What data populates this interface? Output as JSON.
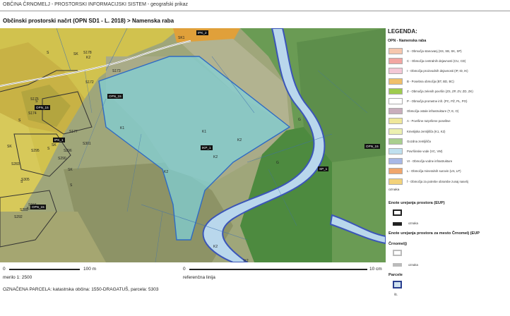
{
  "header": "OBČINA ČRNOMELJ - PROSTORSKI INFORMACIJSKI SISTEM - geografski prikaz",
  "title": "Občinski prostorski načrt (OPN SD1 - L. 2018) > Namenska raba",
  "map": {
    "labels": [
      "K1",
      "K1",
      "K2",
      "K2",
      "K2",
      "K2",
      "K2",
      "K2",
      "S",
      "S",
      "S",
      "S",
      "S",
      "S",
      "SK",
      "SK",
      "SK",
      "SK",
      "SK1",
      "S178",
      "S175",
      "S173",
      "S174",
      "S177",
      "S301",
      "S295",
      "S296",
      "S283",
      "S290",
      "S244",
      "S289",
      "S292",
      "S305",
      "S173",
      "S172",
      "R",
      "G",
      "G",
      "Vr2"
    ],
    "tags": [
      "OPN_15",
      "OPN_15",
      "OPN_15",
      "IPK_1",
      "IKP_1",
      "IPK_2",
      "SP_1",
      "OPN_15"
    ]
  },
  "legend": {
    "title": "LEGENDA:",
    "subtitle": "OPN - Namenska raba",
    "items": [
      {
        "label": "S - Območja stanovanj (SS, SB, SK, SP)",
        "color": "#f6c7ae"
      },
      {
        "label": "C - Območja centralnih dejavnosti (CU, CD)",
        "color": "#f2a6a2"
      },
      {
        "label": "I - Območja proizvodnih dejavnosti (IP, ID, IK)",
        "color": "#f4c8d6"
      },
      {
        "label": "B - Posebna območja (BT, BD, BC)",
        "color": "#f0c06a"
      },
      {
        "label": "Z - Območja zelenih površin (ZS, ZP, ZV, ZD, ZK)",
        "color": "#9fcc4e"
      },
      {
        "label": "P - Območja prometne infr. (PC, PŽ, PL, PO)",
        "color": "#ffffff"
      },
      {
        "label": "Območja ostale infrastrukture (T, E, O)",
        "color": "#c9aebc"
      },
      {
        "label": "A - Površine razpršene poselitve",
        "color": "#efe79a"
      },
      {
        "label": "Kmetijska zemljišča (K1, K2)",
        "color": "#ecf0b0"
      },
      {
        "label": "Gozdna zemljišča",
        "color": "#a9cf8e"
      },
      {
        "label": "Površinske vode (VC, VM)",
        "color": "#bfe0ef"
      },
      {
        "label": "VI - Območja vodne infrastrukture",
        "color": "#a8b8e6"
      },
      {
        "label": "L - Območja mineralnih surovin (LN, LP)",
        "color": "#f0a66c"
      },
      {
        "label": "f - Območja za potrebe obrambe zunaj naselij",
        "color": "#f3d27a"
      }
    ],
    "oznaka_label": "oznaka",
    "eup_title": "Enote urejanja prostora (EUP)",
    "eup_oznaka": "oznaka",
    "eup_crnomelj_title_1": "Enote urejanja prostora za mesto Črnomelj (EUP",
    "eup_crnomelj_title_2": "Črnomelj)",
    "eup_crnomelj_oznaka": "oznaka",
    "parcele_title": "Parcele",
    "parcele_label": "št."
  },
  "scale": {
    "bar1_start": "0",
    "bar1_end": "100 m",
    "bar1_caption": "merilo 1: 2500",
    "bar2_start": "0",
    "bar2_end": "10 cm",
    "bar2_caption": "referenčna linija"
  },
  "footer": "OZNAČENA PARCELA: katastrska občina: 1550-DRAGATUŠ, parcela: 5303"
}
